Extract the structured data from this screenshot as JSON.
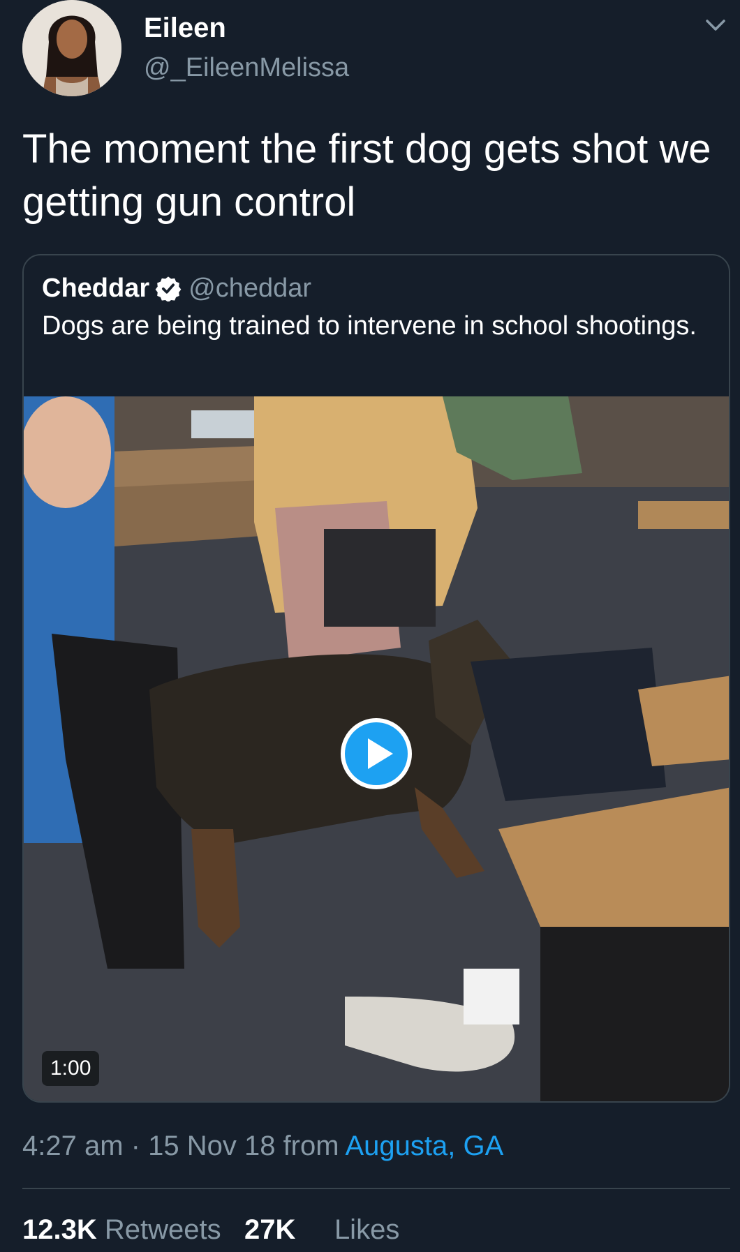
{
  "tweet": {
    "author_name": "Eileen",
    "author_handle": "@_EileenMelissa",
    "text": "The moment the first dog gets shot we getting gun control",
    "time": "4:27 am",
    "date": "15 Nov 18",
    "from_label": "from",
    "location": "Augusta, GA",
    "retweets_count": "12.3K",
    "retweets_label": "Retweets",
    "likes_count": "27K",
    "likes_label": "Likes"
  },
  "quoted": {
    "author_name": "Cheddar",
    "author_handle": "@cheddar",
    "verified": true,
    "text": "Dogs are being trained to intervene in school shootings.",
    "video_duration": "1:00"
  },
  "icons": {
    "menu": "chevron-down-icon",
    "verified": "verified-badge-icon",
    "play": "play-icon"
  },
  "colors": {
    "background": "#151e2a",
    "secondary_text": "#8899a6",
    "link": "#1da1f2",
    "border": "#38444d"
  }
}
